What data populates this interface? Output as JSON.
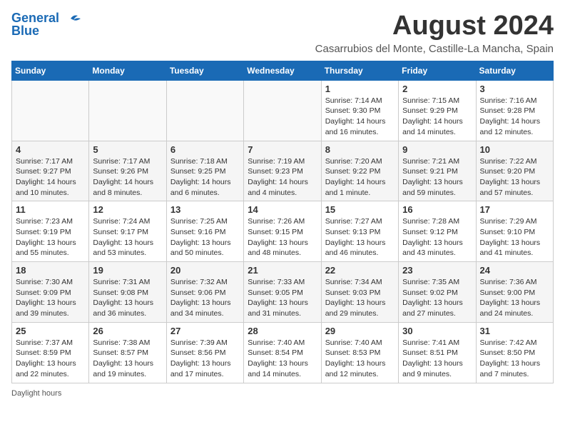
{
  "header": {
    "logo_line1": "General",
    "logo_line2": "Blue",
    "month_title": "August 2024",
    "location": "Casarrubios del Monte, Castille-La Mancha, Spain"
  },
  "days_of_week": [
    "Sunday",
    "Monday",
    "Tuesday",
    "Wednesday",
    "Thursday",
    "Friday",
    "Saturday"
  ],
  "weeks": [
    [
      {
        "day": "",
        "info": ""
      },
      {
        "day": "",
        "info": ""
      },
      {
        "day": "",
        "info": ""
      },
      {
        "day": "",
        "info": ""
      },
      {
        "day": "1",
        "info": "Sunrise: 7:14 AM\nSunset: 9:30 PM\nDaylight: 14 hours and 16 minutes."
      },
      {
        "day": "2",
        "info": "Sunrise: 7:15 AM\nSunset: 9:29 PM\nDaylight: 14 hours and 14 minutes."
      },
      {
        "day": "3",
        "info": "Sunrise: 7:16 AM\nSunset: 9:28 PM\nDaylight: 14 hours and 12 minutes."
      }
    ],
    [
      {
        "day": "4",
        "info": "Sunrise: 7:17 AM\nSunset: 9:27 PM\nDaylight: 14 hours and 10 minutes."
      },
      {
        "day": "5",
        "info": "Sunrise: 7:17 AM\nSunset: 9:26 PM\nDaylight: 14 hours and 8 minutes."
      },
      {
        "day": "6",
        "info": "Sunrise: 7:18 AM\nSunset: 9:25 PM\nDaylight: 14 hours and 6 minutes."
      },
      {
        "day": "7",
        "info": "Sunrise: 7:19 AM\nSunset: 9:23 PM\nDaylight: 14 hours and 4 minutes."
      },
      {
        "day": "8",
        "info": "Sunrise: 7:20 AM\nSunset: 9:22 PM\nDaylight: 14 hours and 1 minute."
      },
      {
        "day": "9",
        "info": "Sunrise: 7:21 AM\nSunset: 9:21 PM\nDaylight: 13 hours and 59 minutes."
      },
      {
        "day": "10",
        "info": "Sunrise: 7:22 AM\nSunset: 9:20 PM\nDaylight: 13 hours and 57 minutes."
      }
    ],
    [
      {
        "day": "11",
        "info": "Sunrise: 7:23 AM\nSunset: 9:19 PM\nDaylight: 13 hours and 55 minutes."
      },
      {
        "day": "12",
        "info": "Sunrise: 7:24 AM\nSunset: 9:17 PM\nDaylight: 13 hours and 53 minutes."
      },
      {
        "day": "13",
        "info": "Sunrise: 7:25 AM\nSunset: 9:16 PM\nDaylight: 13 hours and 50 minutes."
      },
      {
        "day": "14",
        "info": "Sunrise: 7:26 AM\nSunset: 9:15 PM\nDaylight: 13 hours and 48 minutes."
      },
      {
        "day": "15",
        "info": "Sunrise: 7:27 AM\nSunset: 9:13 PM\nDaylight: 13 hours and 46 minutes."
      },
      {
        "day": "16",
        "info": "Sunrise: 7:28 AM\nSunset: 9:12 PM\nDaylight: 13 hours and 43 minutes."
      },
      {
        "day": "17",
        "info": "Sunrise: 7:29 AM\nSunset: 9:10 PM\nDaylight: 13 hours and 41 minutes."
      }
    ],
    [
      {
        "day": "18",
        "info": "Sunrise: 7:30 AM\nSunset: 9:09 PM\nDaylight: 13 hours and 39 minutes."
      },
      {
        "day": "19",
        "info": "Sunrise: 7:31 AM\nSunset: 9:08 PM\nDaylight: 13 hours and 36 minutes."
      },
      {
        "day": "20",
        "info": "Sunrise: 7:32 AM\nSunset: 9:06 PM\nDaylight: 13 hours and 34 minutes."
      },
      {
        "day": "21",
        "info": "Sunrise: 7:33 AM\nSunset: 9:05 PM\nDaylight: 13 hours and 31 minutes."
      },
      {
        "day": "22",
        "info": "Sunrise: 7:34 AM\nSunset: 9:03 PM\nDaylight: 13 hours and 29 minutes."
      },
      {
        "day": "23",
        "info": "Sunrise: 7:35 AM\nSunset: 9:02 PM\nDaylight: 13 hours and 27 minutes."
      },
      {
        "day": "24",
        "info": "Sunrise: 7:36 AM\nSunset: 9:00 PM\nDaylight: 13 hours and 24 minutes."
      }
    ],
    [
      {
        "day": "25",
        "info": "Sunrise: 7:37 AM\nSunset: 8:59 PM\nDaylight: 13 hours and 22 minutes."
      },
      {
        "day": "26",
        "info": "Sunrise: 7:38 AM\nSunset: 8:57 PM\nDaylight: 13 hours and 19 minutes."
      },
      {
        "day": "27",
        "info": "Sunrise: 7:39 AM\nSunset: 8:56 PM\nDaylight: 13 hours and 17 minutes."
      },
      {
        "day": "28",
        "info": "Sunrise: 7:40 AM\nSunset: 8:54 PM\nDaylight: 13 hours and 14 minutes."
      },
      {
        "day": "29",
        "info": "Sunrise: 7:40 AM\nSunset: 8:53 PM\nDaylight: 13 hours and 12 minutes."
      },
      {
        "day": "30",
        "info": "Sunrise: 7:41 AM\nSunset: 8:51 PM\nDaylight: 13 hours and 9 minutes."
      },
      {
        "day": "31",
        "info": "Sunrise: 7:42 AM\nSunset: 8:50 PM\nDaylight: 13 hours and 7 minutes."
      }
    ]
  ],
  "footer": {
    "note": "Daylight hours"
  }
}
